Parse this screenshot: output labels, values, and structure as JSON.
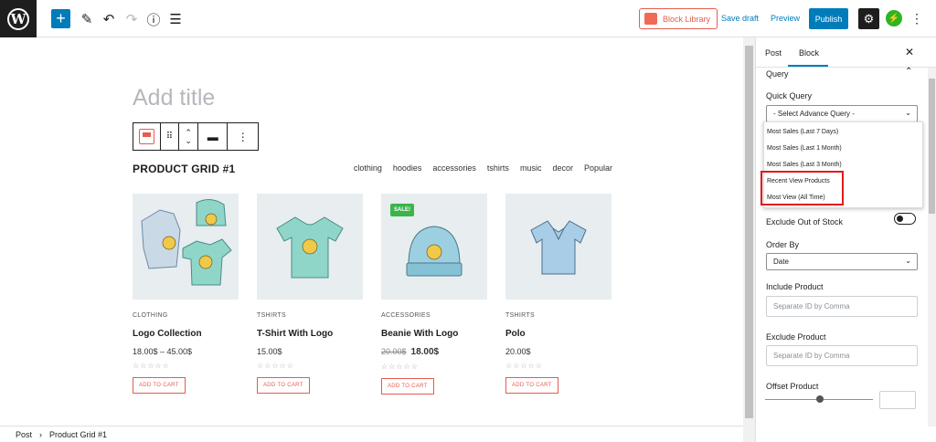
{
  "toolbar": {
    "block_library": "Block Library",
    "save_draft": "Save draft",
    "preview": "Preview",
    "publish": "Publish"
  },
  "editor": {
    "title_placeholder": "Add title",
    "grid_title": "PRODUCT GRID #1",
    "filters": [
      "clothing",
      "hoodies",
      "accessories",
      "tshirts",
      "music",
      "decor",
      "Popular"
    ],
    "products": [
      {
        "category": "CLOTHING",
        "name": "Logo Collection",
        "price": "18.00$ – 45.00$",
        "cart": "ADD TO CART"
      },
      {
        "category": "TSHIRTS",
        "name": "T-Shirt With Logo",
        "price": "15.00$",
        "cart": "ADD TO CART"
      },
      {
        "category": "ACCESSORIES",
        "name": "Beanie With Logo",
        "old_price": "20.00$",
        "new_price": "18.00$",
        "badge": "SALE!",
        "cart": "ADD TO CART"
      },
      {
        "category": "TSHIRTS",
        "name": "Polo",
        "price": "20.00$",
        "cart": "ADD TO CART"
      }
    ]
  },
  "breadcrumb": {
    "root": "Post",
    "current": "Product Grid #1"
  },
  "sidebar": {
    "tabs": [
      "Post",
      "Block"
    ],
    "section": "Query",
    "quick_query_label": "Quick Query",
    "quick_query_value": "- Select Advance Query -",
    "dropdown_options": [
      "Most Sales (Last 7 Days)",
      "Most Sales (Last 1 Month)",
      "Most Sales (Last 3 Month)",
      "Recent View Products",
      "Most View (All Time)"
    ],
    "exclude_stock": "Exclude Out of Stock",
    "order_by_label": "Order By",
    "order_by_value": "Date",
    "include_label": "Include Product",
    "include_placeholder": "Separate ID by Comma",
    "exclude_label": "Exclude Product",
    "exclude_placeholder": "Separate ID by Comma",
    "offset_label": "Offset Product"
  },
  "colors": {
    "accent": "#007cba",
    "brand": "#e65c4f",
    "sale": "#3bb54a",
    "highlight": "#e21b1b"
  }
}
